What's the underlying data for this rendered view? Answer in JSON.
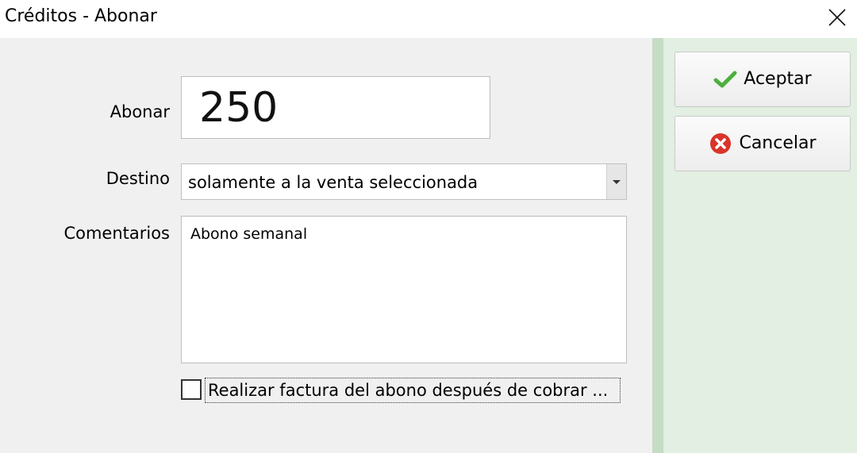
{
  "window": {
    "title": "Créditos - Abonar"
  },
  "form": {
    "abonar_label": "Abonar",
    "abonar_value": "250",
    "destino_label": "Destino",
    "destino_value": "solamente a la venta seleccionada",
    "comentarios_label": "Comentarios",
    "comentarios_value": "Abono semanal",
    "factura_label": "Realizar factura del abono después de cobrar ...",
    "factura_checked": false
  },
  "buttons": {
    "accept_label": "Aceptar",
    "cancel_label": "Cancelar"
  },
  "icons": {
    "accept": "checkmark-icon",
    "cancel": "cancel-icon",
    "close": "close-icon"
  },
  "colors": {
    "accept_check": "#4caf3d",
    "cancel_red": "#d9342b",
    "side_panel": "#e2efe2"
  }
}
